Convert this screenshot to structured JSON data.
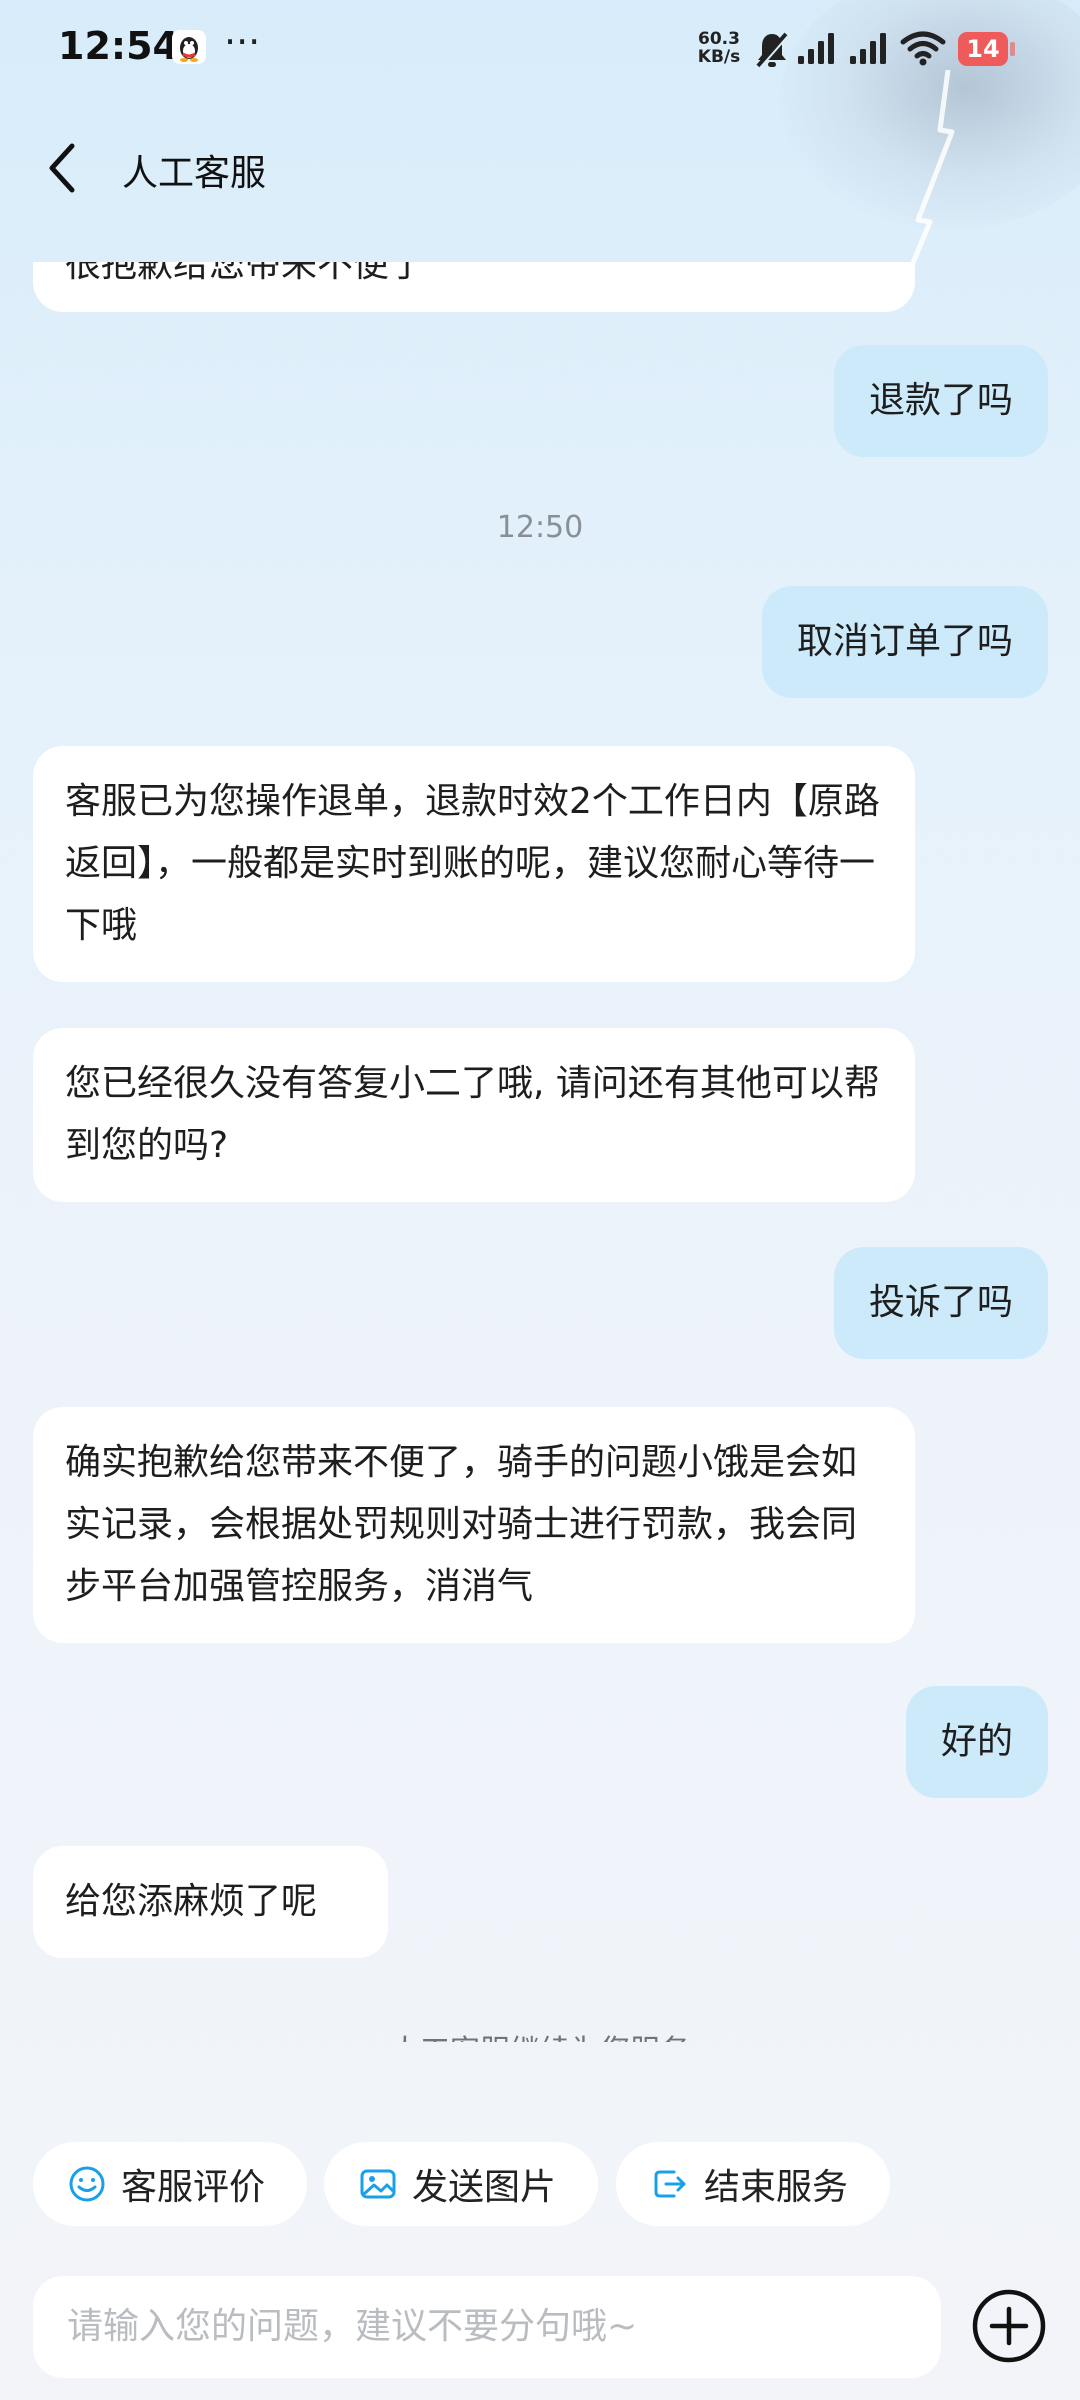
{
  "status_bar": {
    "time": "12:54",
    "more": "···",
    "net_speed_value": "60.3",
    "net_speed_unit": "KB/s",
    "battery": "14"
  },
  "header": {
    "title": "人工客服"
  },
  "messages": [
    {
      "side": "left",
      "text": "很抱歉给您带来不便了"
    },
    {
      "side": "right",
      "text": "退款了吗"
    },
    {
      "type": "time",
      "text": "12:50"
    },
    {
      "side": "right",
      "text": "取消订单了吗"
    },
    {
      "side": "left",
      "text": "客服已为您操作退单，退款时效2个工作日内【原路返回】，一般都是实时到账的呢，建议您耐心等待一下哦"
    },
    {
      "side": "left",
      "text": "您已经很久没有答复小二了哦, 请问还有其他可以帮到您的吗?"
    },
    {
      "side": "right",
      "text": "投诉了吗"
    },
    {
      "side": "left",
      "text": "确实抱歉给您带来不便了，骑手的问题小饿是会如实记录，会根据处罚规则对骑士进行罚款，我会同步平台加强管控服务，消消气"
    },
    {
      "side": "right",
      "text": "好的"
    },
    {
      "side": "left",
      "text": "给您添麻烦了呢"
    }
  ],
  "system_note": "人工客服继续为您服务",
  "quick_actions": {
    "rate": "客服评价",
    "send_image": "发送图片",
    "end_service": "结束服务"
  },
  "input": {
    "placeholder": "请输入您的问题，建议不要分句哦~"
  },
  "colors": {
    "user_bubble": "#cdeafb",
    "agent_bubble": "#ffffff",
    "accent_icon": "#1aa0e8",
    "battery": "#ef5a5a"
  },
  "icons": [
    "qq-penguin-icon",
    "mute-bell-icon",
    "signal-icon",
    "wifi-icon",
    "back-chevron-icon",
    "smile-icon",
    "image-icon",
    "exit-icon",
    "plus-circle-icon"
  ]
}
